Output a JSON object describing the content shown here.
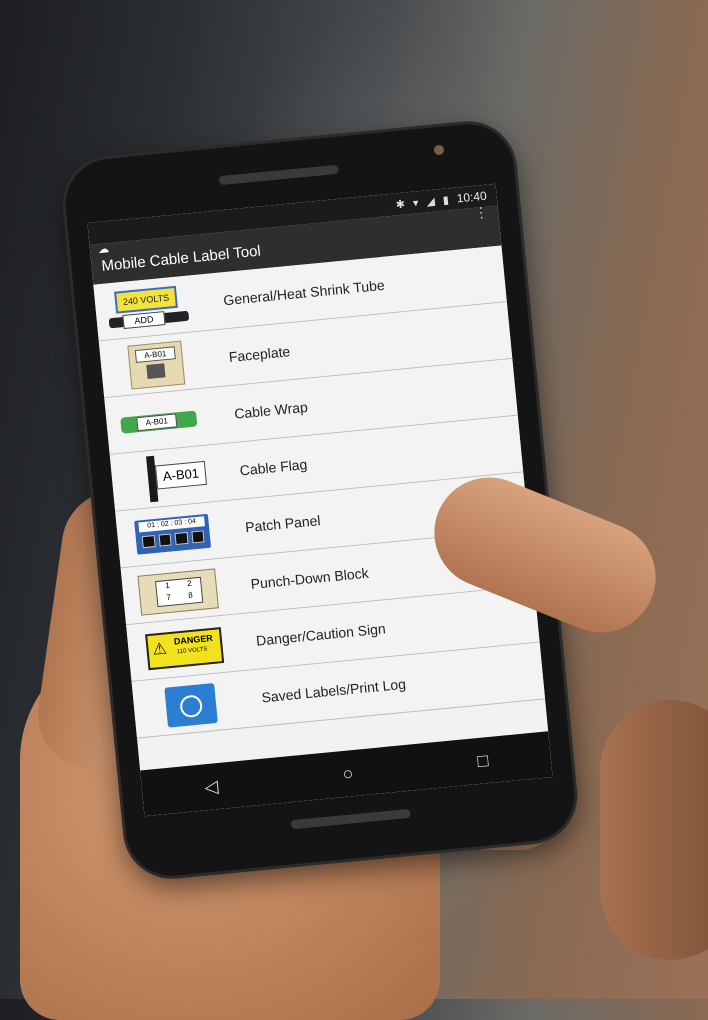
{
  "status": {
    "time": "10:40",
    "icons": [
      "bluetooth-icon",
      "wifi-icon",
      "signal-icon",
      "battery-icon"
    ]
  },
  "app": {
    "title": "Mobile Cable Label Tool"
  },
  "items": [
    {
      "label": "General/Heat Shrink Tube",
      "thumb_text": "240 VOLTS",
      "thumb_sub": "ADD"
    },
    {
      "label": "Faceplate",
      "thumb_text": "A-B01"
    },
    {
      "label": "Cable Wrap",
      "thumb_text": "A-B01"
    },
    {
      "label": "Cable Flag",
      "thumb_text": "A-B01"
    },
    {
      "label": "Patch Panel",
      "thumb_text": "01 : 02 : 03 : 04"
    },
    {
      "label": "Punch-Down Block",
      "thumb_text": [
        "1",
        "2",
        "7",
        "8"
      ]
    },
    {
      "label": "Danger/Caution Sign",
      "thumb_text": "DANGER",
      "thumb_sub": "110 VOLTS"
    },
    {
      "label": "Saved Labels/Print Log"
    }
  ],
  "navbar": {
    "back": "◁",
    "home": "○",
    "recents": "□"
  }
}
